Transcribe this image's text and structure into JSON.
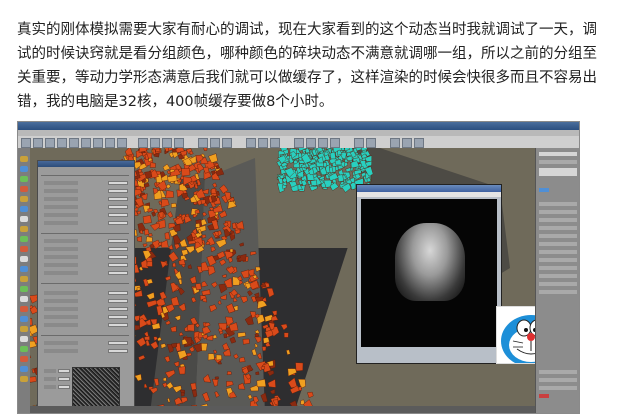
{
  "article": {
    "paragraph": "真实的刚体模拟需要大家有耐心的调试，现在大家看到的这个动态当时我就调试了一天，调试的时候诀窍就是看分组颜色，哪种颜色的碎块动态不满意就调哪一组，所以之前的分组至关重要，等动力学形态满意后我们就可以做缓存了，这样渲染的时候会快很多而且不容易出错，我的电脑是32核，400帧缓存要做8个小时。"
  },
  "screenshot": {
    "description_icons": [
      "max-app-icon",
      "render-frame-window",
      "doraemon-sticker"
    ],
    "colors": {
      "viewport_bg": "#6f6a5a",
      "fragments_primary": "#d94a1a",
      "fragments_secondary": "#f0a020",
      "fragments_selected": "#28d0c0",
      "titlebar": "#2b4f80"
    }
  }
}
